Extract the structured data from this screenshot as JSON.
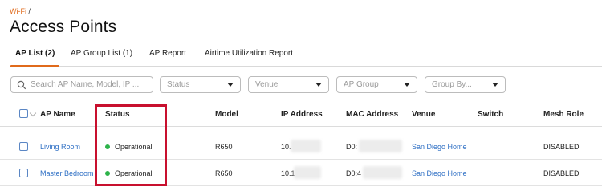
{
  "breadcrumb": {
    "link": "Wi-Fi",
    "separator": "/"
  },
  "page_title": "Access Points",
  "tabs": [
    {
      "label": "AP List (2)",
      "active": true
    },
    {
      "label": "AP Group List (1)",
      "active": false
    },
    {
      "label": "AP Report",
      "active": false
    },
    {
      "label": "Airtime Utilization Report",
      "active": false
    }
  ],
  "filters": {
    "search_placeholder": "Search AP Name, Model, IP ...",
    "status_placeholder": "Status",
    "venue_placeholder": "Venue",
    "ap_group_placeholder": "AP Group",
    "group_by_placeholder": "Group By..."
  },
  "table": {
    "columns": [
      "AP Name",
      "Status",
      "Model",
      "IP Address",
      "MAC Address",
      "Venue",
      "Switch",
      "Mesh Role"
    ],
    "rows": [
      {
        "ap_name": "Living Room",
        "status": "Operational",
        "model": "R650",
        "ip": "10.",
        "mac": "D0:",
        "venue": "San Diego Home",
        "switch": "",
        "mesh_role": "DISABLED"
      },
      {
        "ap_name": "Master Bedroom",
        "status": "Operational",
        "model": "R650",
        "ip": "10.1",
        "mac": "D0:4",
        "venue": "San Diego Home",
        "switch": "",
        "mesh_role": "DISABLED"
      }
    ]
  },
  "colors": {
    "accent": "#e06a1b",
    "link": "#2e6fc4",
    "status_ok": "#2db34a",
    "highlight": "#c8102e"
  }
}
